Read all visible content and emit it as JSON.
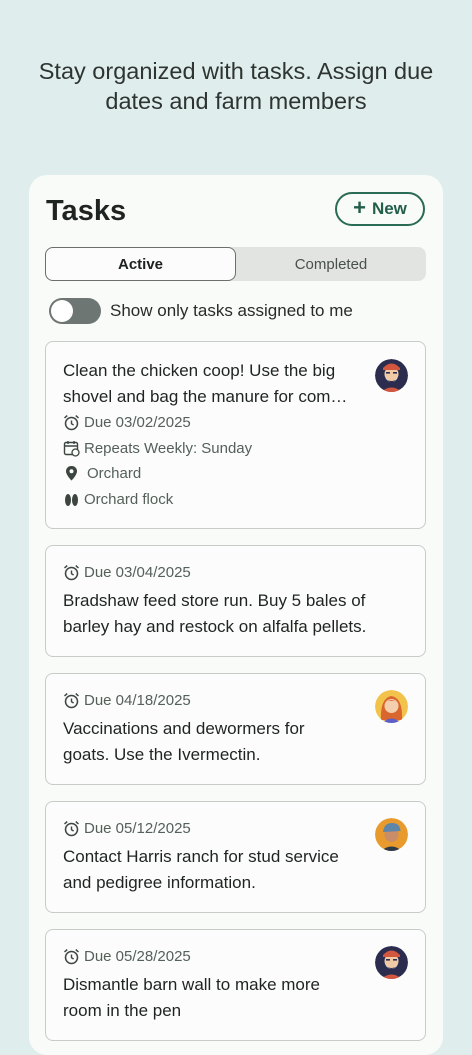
{
  "promo": {
    "line1": "Stay organized with tasks. Assign due",
    "line2": "dates and farm members"
  },
  "header": {
    "title": "Tasks",
    "new_label": "New"
  },
  "tabs": {
    "active": "Active",
    "completed": "Completed"
  },
  "filter": {
    "label": "Show only tasks assigned to me",
    "enabled": false
  },
  "tasks": [
    {
      "desc_line1": "Clean the chicken coop! Use the big",
      "desc_line2": "shovel and bag the manure for com…",
      "due": "Due 03/02/2025",
      "repeats": "Repeats Weekly: Sunday",
      "location": "Orchard",
      "group": "Orchard flock",
      "avatar": "bearded-man"
    },
    {
      "due": "Due 03/04/2025",
      "desc_line1": "Bradshaw feed store run. Buy 5 bales of",
      "desc_line2": "barley hay and restock on alfalfa pellets."
    },
    {
      "due": "Due 04/18/2025",
      "desc_line1": "Vaccinations and dewormers for",
      "desc_line2": "goats. Use the Ivermectin.",
      "avatar": "red-haired-woman"
    },
    {
      "due": "Due 05/12/2025",
      "desc_line1": "Contact Harris ranch for stud service",
      "desc_line2": "and pedigree information.",
      "avatar": "man-with-cap"
    },
    {
      "due": "Due 05/28/2025",
      "desc_line1": "Dismantle barn wall to make more",
      "desc_line2": "room in the pen",
      "avatar": "bearded-man"
    }
  ],
  "colors": {
    "background": "#dfeeec",
    "accent": "#2a6b55",
    "toggle_off": "#6e7673"
  }
}
